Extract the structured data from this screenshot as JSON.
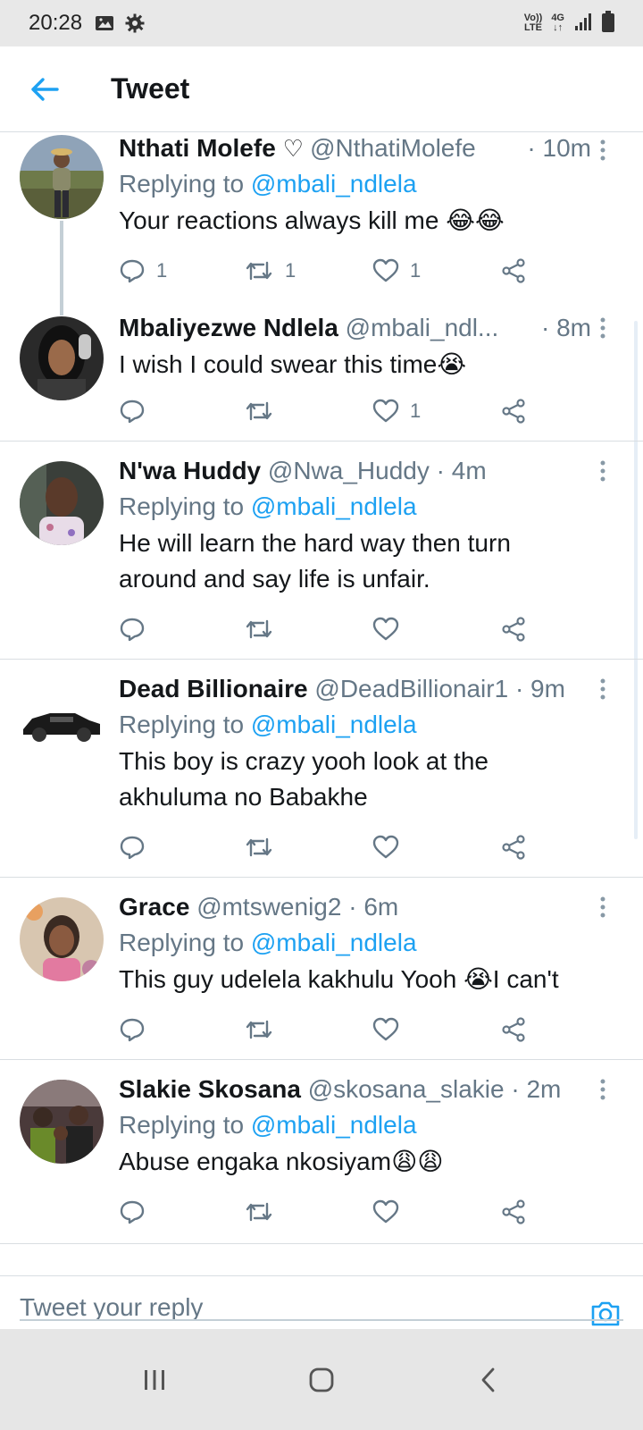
{
  "status_bar": {
    "time": "20:28",
    "network_top": "Vo))",
    "network_bottom": "LTE",
    "signal_label": "4G",
    "icons": [
      "image-icon",
      "settings-gear-icon",
      "volte-icon",
      "4g-icon",
      "signal-icon",
      "battery-icon"
    ]
  },
  "header": {
    "title": "Tweet"
  },
  "tweets": [
    {
      "name": "Nthati Molefe",
      "handle": "@NthatiMolefe",
      "time": "· 10m",
      "replying_prefix": "Replying to",
      "replying_to": "@mbali_ndlela",
      "text": "Your reactions always kill me",
      "text_emoji": "😂😂",
      "reply_count": "1",
      "retweet_count": "1",
      "like_count": "1"
    },
    {
      "name": "Mbaliyezwe Ndlela",
      "handle": "@mbali_ndl...",
      "time": "· 8m",
      "text": "I wish I could swear this time",
      "text_emoji": "😭",
      "reply_count": "",
      "retweet_count": "",
      "like_count": "1"
    },
    {
      "name": "N'wa Huddy",
      "handle": "@Nwa_Huddy",
      "time": "· 4m",
      "replying_prefix": "Replying to",
      "replying_to": "@mbali_ndlela",
      "text": "He will learn the hard way then turn around and say life is unfair."
    },
    {
      "name": "Dead Billionaire",
      "handle": "@DeadBillionair1",
      "time": "· 9m",
      "replying_prefix": "Replying to",
      "replying_to": "@mbali_ndlela",
      "text": "This boy is crazy yooh look at the akhuluma no Babakhe"
    },
    {
      "name": "Grace",
      "handle": "@mtswenig2",
      "time": "· 6m",
      "replying_prefix": "Replying to",
      "replying_to": "@mbali_ndlela",
      "text_before": "This guy udelela kakhulu Yooh",
      "text_emoji": "😭",
      "text_after": "I can't"
    },
    {
      "name": "Slakie Skosana",
      "handle": "@skosana_slakie",
      "time": "· 2m",
      "replying_prefix": "Replying to",
      "replying_to": "@mbali_ndlela",
      "text": "Abuse engaka nkosiyam",
      "text_emoji": "😩😩"
    }
  ],
  "reply_bar": {
    "placeholder": "Tweet your reply"
  },
  "nav_bar": {
    "icons": [
      "recent-apps-icon",
      "home-icon",
      "back-nav-icon"
    ]
  },
  "colors": {
    "accent": "#1da1f2",
    "text_primary": "#14171a",
    "text_secondary": "#657786",
    "divider": "#d9dee2",
    "status_bar_bg": "#e8e8e8",
    "nav_bar_bg": "#e6e6e6"
  }
}
